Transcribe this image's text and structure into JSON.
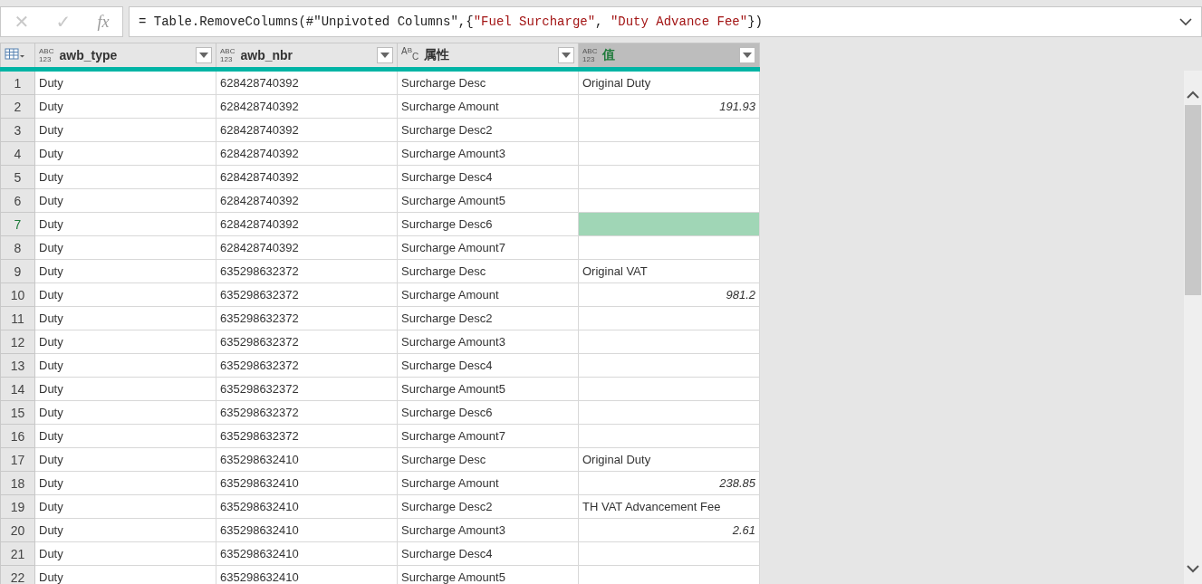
{
  "formula_bar": {
    "cancel": "✕",
    "confirm": "✓",
    "fx": "fx",
    "formula": [
      {
        "text": "= Table.RemoveColumns(#\"Unpivoted Columns\",{",
        "kind": "code"
      },
      {
        "text": "\"Fuel Surcharge\"",
        "kind": "string"
      },
      {
        "text": ", ",
        "kind": "code"
      },
      {
        "text": "\"Duty Advance Fee\"",
        "kind": "string"
      },
      {
        "text": "})",
        "kind": "code"
      }
    ]
  },
  "table": {
    "columns": [
      {
        "name": "awb_type",
        "kind": "any",
        "type_label": [
          "ABC",
          "123"
        ],
        "selected": false
      },
      {
        "name": "awb_nbr",
        "kind": "any",
        "type_label": [
          "ABC",
          "123"
        ],
        "selected": false
      },
      {
        "name": "属性",
        "kind": "text",
        "type_label": [
          "A",
          "B",
          "C"
        ],
        "selected": false
      },
      {
        "name": "值",
        "kind": "any",
        "type_label": [
          "ABC",
          "123"
        ],
        "selected": true
      }
    ],
    "rows": [
      {
        "n": "1",
        "cells": [
          "Duty",
          "628428740392",
          "Surcharge Desc"
        ],
        "value": "Original Duty",
        "kind": "text",
        "selected": false
      },
      {
        "n": "2",
        "cells": [
          "Duty",
          "628428740392",
          "Surcharge Amount"
        ],
        "value": "191.93",
        "kind": "number",
        "selected": false
      },
      {
        "n": "3",
        "cells": [
          "Duty",
          "628428740392",
          "Surcharge Desc2"
        ],
        "selected": false
      },
      {
        "n": "4",
        "cells": [
          "Duty",
          "628428740392",
          "Surcharge Amount3"
        ],
        "selected": false
      },
      {
        "n": "5",
        "cells": [
          "Duty",
          "628428740392",
          "Surcharge Desc4"
        ],
        "selected": false
      },
      {
        "n": "6",
        "cells": [
          "Duty",
          "628428740392",
          "Surcharge Amount5"
        ],
        "selected": false
      },
      {
        "n": "7",
        "cells": [
          "Duty",
          "628428740392",
          "Surcharge Desc6"
        ],
        "selected": true
      },
      {
        "n": "8",
        "cells": [
          "Duty",
          "628428740392",
          "Surcharge Amount7"
        ],
        "selected": false
      },
      {
        "n": "9",
        "cells": [
          "Duty",
          "635298632372",
          "Surcharge Desc"
        ],
        "value": "Original VAT",
        "kind": "text",
        "selected": false
      },
      {
        "n": "10",
        "cells": [
          "Duty",
          "635298632372",
          "Surcharge Amount"
        ],
        "value": "981.2",
        "kind": "number",
        "selected": false
      },
      {
        "n": "11",
        "cells": [
          "Duty",
          "635298632372",
          "Surcharge Desc2"
        ],
        "selected": false
      },
      {
        "n": "12",
        "cells": [
          "Duty",
          "635298632372",
          "Surcharge Amount3"
        ],
        "selected": false
      },
      {
        "n": "13",
        "cells": [
          "Duty",
          "635298632372",
          "Surcharge Desc4"
        ],
        "selected": false
      },
      {
        "n": "14",
        "cells": [
          "Duty",
          "635298632372",
          "Surcharge Amount5"
        ],
        "selected": false
      },
      {
        "n": "15",
        "cells": [
          "Duty",
          "635298632372",
          "Surcharge Desc6"
        ],
        "selected": false
      },
      {
        "n": "16",
        "cells": [
          "Duty",
          "635298632372",
          "Surcharge Amount7"
        ],
        "selected": false
      },
      {
        "n": "17",
        "cells": [
          "Duty",
          "635298632410",
          "Surcharge Desc"
        ],
        "value": "Original Duty",
        "kind": "text",
        "selected": false
      },
      {
        "n": "18",
        "cells": [
          "Duty",
          "635298632410",
          "Surcharge Amount"
        ],
        "value": "238.85",
        "kind": "number",
        "selected": false
      },
      {
        "n": "19",
        "cells": [
          "Duty",
          "635298632410",
          "Surcharge Desc2"
        ],
        "value": "TH VAT Advancement Fee",
        "kind": "text",
        "selected": false
      },
      {
        "n": "20",
        "cells": [
          "Duty",
          "635298632410",
          "Surcharge Amount3"
        ],
        "value": "2.61",
        "kind": "number",
        "selected": false
      },
      {
        "n": "21",
        "cells": [
          "Duty",
          "635298632410",
          "Surcharge Desc4"
        ],
        "selected": false
      },
      {
        "n": "22",
        "cells": [
          "Duty",
          "635298632410",
          "Surcharge Amount5"
        ],
        "selected": false
      }
    ]
  }
}
